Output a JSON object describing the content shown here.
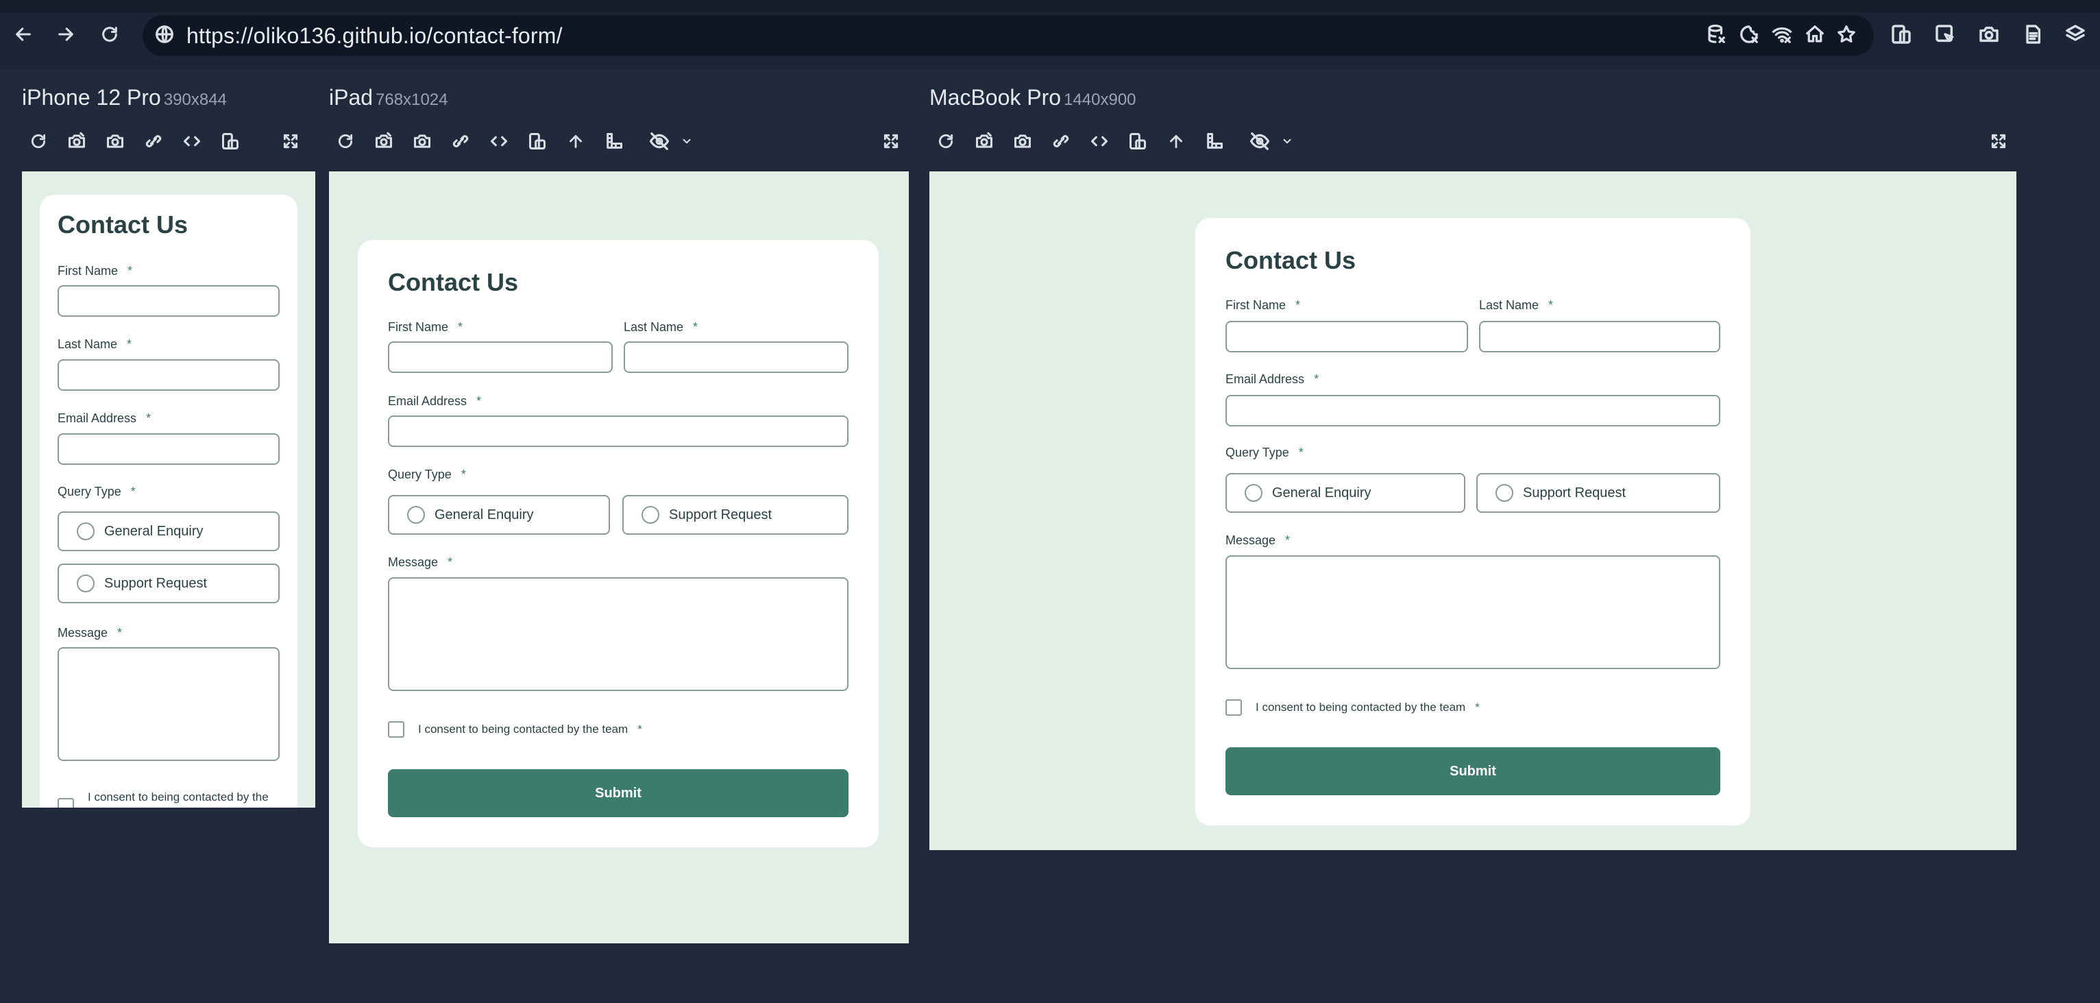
{
  "browser": {
    "url": "https://oliko136.github.io/contact-form/",
    "icons": [
      "back-arrow-icon",
      "forward-arrow-icon",
      "reload-icon",
      "site-info-icon",
      "database-icon",
      "cookie-icon",
      "wifi-off-icon",
      "home-icon",
      "star-icon",
      "responsive-icon",
      "cursor-icon",
      "camera-icon",
      "file-icon",
      "layers-icon"
    ]
  },
  "device_toolbar_icons": [
    "refresh-icon",
    "screenshot-full-icon",
    "camera-icon",
    "link-icon",
    "code-icon",
    "rotate-icon",
    "scroll-up-icon",
    "ruler-icon",
    "eye-off-icon",
    "chevron-down-icon",
    "fullscreen-icon"
  ],
  "devices": [
    {
      "name": "iPhone 12 Pro",
      "dims": "390x844"
    },
    {
      "name": "iPad",
      "dims": "768x1024"
    },
    {
      "name": "MacBook Pro",
      "dims": "1440x900"
    }
  ],
  "form": {
    "title": "Contact Us",
    "first_name_label": "First Name",
    "last_name_label": "Last Name",
    "email_label": "Email Address",
    "query_type_label": "Query Type",
    "query_options": [
      "General Enquiry",
      "Support Request"
    ],
    "message_label": "Message",
    "consent_label": "I consent to being contacted by the team",
    "consent_label_truncated": "I consent to being contacted by the",
    "required_mark": "*",
    "submit_label": "Submit"
  },
  "colors": {
    "page_bg": "#202a3a",
    "form_bg": "#e2efe6",
    "accent": "#3c7c6c",
    "text": "#2a4244"
  }
}
